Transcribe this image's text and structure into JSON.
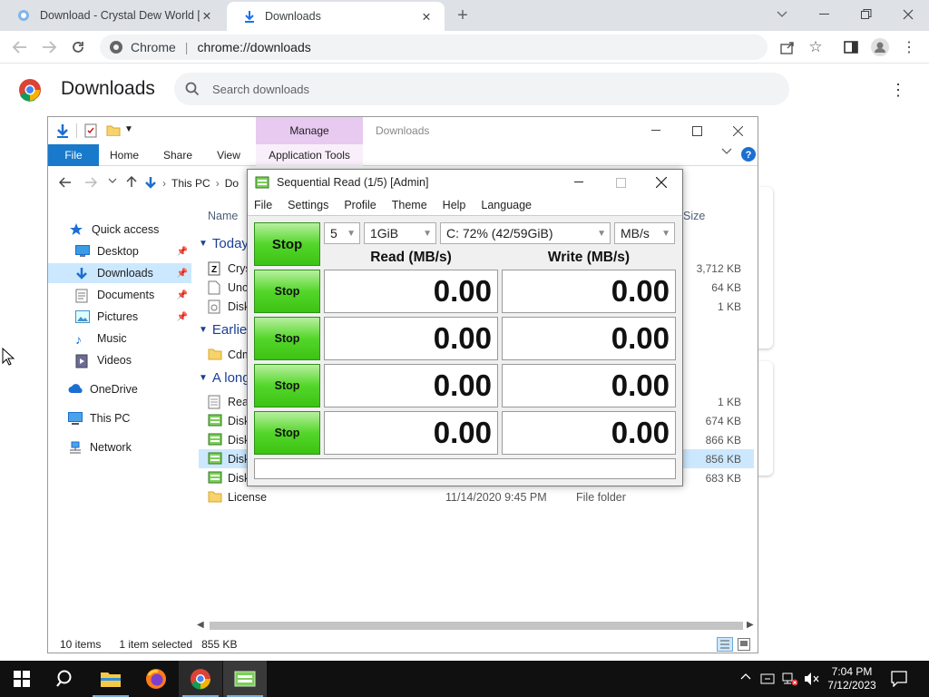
{
  "browser": {
    "tabs": [
      {
        "title": "Download - Crystal Dew World [e",
        "active": false
      },
      {
        "title": "Downloads",
        "active": true
      }
    ],
    "site_chip": "Chrome",
    "url": "chrome://downloads"
  },
  "downloads_page": {
    "title": "Downloads",
    "search_placeholder": "Search downloads"
  },
  "explorer": {
    "ribbon": {
      "manage_label": "Manage",
      "window_title": "Downloads",
      "tabs": [
        "File",
        "Home",
        "Share",
        "View",
        "Application Tools"
      ]
    },
    "breadcrumb": [
      "This PC",
      "Do"
    ],
    "column_name": "Name",
    "column_size": "Size",
    "nav": [
      {
        "label": "Quick access",
        "icon": "star-icon"
      },
      {
        "label": "Desktop",
        "icon": "desktop-icon",
        "pinned": true
      },
      {
        "label": "Downloads",
        "icon": "download-arrow-icon",
        "pinned": true,
        "selected": true
      },
      {
        "label": "Documents",
        "icon": "documents-icon",
        "pinned": true
      },
      {
        "label": "Pictures",
        "icon": "pictures-icon",
        "pinned": true
      },
      {
        "label": "Music",
        "icon": "music-icon"
      },
      {
        "label": "Videos",
        "icon": "videos-icon"
      },
      {
        "label": "OneDrive",
        "icon": "cloud-icon"
      },
      {
        "label": "This PC",
        "icon": "computer-icon"
      },
      {
        "label": "Network",
        "icon": "network-icon"
      }
    ],
    "groups": [
      {
        "label": "Today",
        "rows": [
          {
            "name": "Crys",
            "size": "3,712 KB"
          },
          {
            "name": "Unc",
            "size": "64 KB"
          },
          {
            "name": "Disk",
            "size": "1 KB"
          }
        ]
      },
      {
        "label": "Earlie",
        "rows": [
          {
            "name": "Cdm",
            "size": ""
          }
        ]
      },
      {
        "label": "A long",
        "rows": [
          {
            "name": "Read",
            "size": "1 KB"
          },
          {
            "name": "Disk",
            "size": "674 KB"
          },
          {
            "name": "Disk",
            "size": "866 KB"
          },
          {
            "name": "Disk",
            "size": "856 KB",
            "selected": true
          },
          {
            "name": "Disk",
            "size": "683 KB"
          },
          {
            "name": "License",
            "date": "11/14/2020 9:45 PM",
            "type": "File folder",
            "size": ""
          }
        ]
      }
    ],
    "status": {
      "items": "10 items",
      "selected": "1 item selected",
      "size": "855 KB"
    }
  },
  "diskmark": {
    "title": "Sequential Read (1/5) [Admin]",
    "menu": [
      "File",
      "Settings",
      "Profile",
      "Theme",
      "Help",
      "Language"
    ],
    "main_button": "Stop",
    "count": "5",
    "size": "1GiB",
    "drive": "C: 72% (42/59GiB)",
    "unit": "MB/s",
    "read_header": "Read (MB/s)",
    "write_header": "Write (MB/s)",
    "rows": [
      {
        "button": "Stop",
        "read": "0.00",
        "write": "0.00"
      },
      {
        "button": "Stop",
        "read": "0.00",
        "write": "0.00"
      },
      {
        "button": "Stop",
        "read": "0.00",
        "write": "0.00"
      },
      {
        "button": "Stop",
        "read": "0.00",
        "write": "0.00"
      }
    ],
    "comment": ""
  },
  "taskbar": {
    "time": "7:04 PM",
    "date": "7/12/2023"
  }
}
